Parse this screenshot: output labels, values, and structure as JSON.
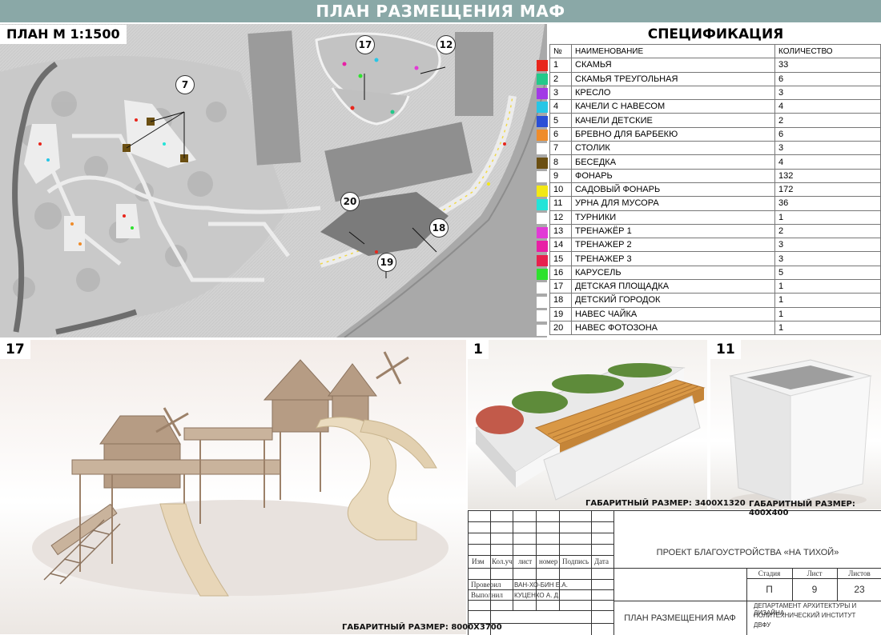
{
  "header": {
    "title": "ПЛАН РАЗМЕЩЕНИЯ МАФ"
  },
  "plan": {
    "label": "ПЛАН М 1:1500",
    "callouts": [
      "7",
      "17",
      "12",
      "20",
      "18",
      "19"
    ]
  },
  "spec": {
    "title": "СПЕЦИФИКАЦИЯ",
    "headers": {
      "num": "№",
      "name": "НАИМЕНОВАНИЕ",
      "qty": "КОЛИЧЕСТВО"
    },
    "rows": [
      {
        "num": "1",
        "name": "СКАМЬЯ",
        "qty": "33",
        "color": "#e8261c"
      },
      {
        "num": "2",
        "name": "СКАМЬЯ ТРЕУГОЛЬНАЯ",
        "qty": "6",
        "color": "#23c98a"
      },
      {
        "num": "3",
        "name": "КРЕСЛО",
        "qty": "3",
        "color": "#a23ae6"
      },
      {
        "num": "4",
        "name": "КАЧЕЛИ С НАВЕСОМ",
        "qty": "4",
        "color": "#27c6e6"
      },
      {
        "num": "5",
        "name": "КАЧЕЛИ ДЕТСКИЕ",
        "qty": "2",
        "color": "#2a4fd6"
      },
      {
        "num": "6",
        "name": "БРЕВНО ДЛЯ БАРБЕКЮ",
        "qty": "6",
        "color": "#ef8c2a"
      },
      {
        "num": "7",
        "name": "СТОЛИК",
        "qty": "3",
        "color": "#ffffff"
      },
      {
        "num": "8",
        "name": "БЕСЕДКА",
        "qty": "4",
        "color": "#6b4f12"
      },
      {
        "num": "9",
        "name": "ФОНАРЬ",
        "qty": "132",
        "color": "#ffffff"
      },
      {
        "num": "10",
        "name": "САДОВЫЙ ФОНАРЬ",
        "qty": "172",
        "color": "#f3e814"
      },
      {
        "num": "11",
        "name": "УРНА ДЛЯ МУСОРА",
        "qty": "36",
        "color": "#24e4d8"
      },
      {
        "num": "12",
        "name": "ТУРНИКИ",
        "qty": "1",
        "color": "#ffffff"
      },
      {
        "num": "13",
        "name": "ТРЕНАЖЁР 1",
        "qty": "2",
        "color": "#e23ad6"
      },
      {
        "num": "14",
        "name": "ТРЕНАЖЕР 2",
        "qty": "3",
        "color": "#e81fa5"
      },
      {
        "num": "15",
        "name": "ТРЕНАЖЕР 3",
        "qty": "3",
        "color": "#e8214d"
      },
      {
        "num": "16",
        "name": "КАРУСЕЛЬ",
        "qty": "5",
        "color": "#2ee22e"
      },
      {
        "num": "17",
        "name": "ДЕТСКАЯ ПЛОЩАДКА",
        "qty": "1",
        "color": "#ffffff"
      },
      {
        "num": "18",
        "name": "ДЕТСКИЙ ГОРОДОК",
        "qty": "1",
        "color": "#ffffff"
      },
      {
        "num": "19",
        "name": "НАВЕС ЧАЙКА",
        "qty": "1",
        "color": "#ffffff"
      },
      {
        "num": "20",
        "name": "НАВЕС ФОТОЗОНА",
        "qty": "1",
        "color": "#ffffff"
      }
    ]
  },
  "panels": {
    "p17": {
      "num": "17",
      "caption": "ГАБАРИТНЫЙ РАЗМЕР: 8000Х3700"
    },
    "p1": {
      "num": "1",
      "caption": "ГАБАРИТНЫЙ РАЗМЕР: 3400Х1320"
    },
    "p11": {
      "num": "11",
      "caption": "ГАБАРИТНЫЙ РАЗМЕР: 400Х400"
    }
  },
  "stamp": {
    "project": "ПРОЕКТ БЛАГОУСТРОЙСТВА «НА ТИХОЙ»",
    "cols": [
      "Изм",
      "Кол.уч",
      "лист",
      "номер",
      "Подпись",
      "Дата"
    ],
    "checked_label": "Проверил",
    "checked_name": "ВАН-ХО-БИН Е.А.",
    "done_label": "Выполнил",
    "done_name": "КУЦЕНКО А. Д.",
    "stage_label": "Стадия",
    "sheet_label": "Лист",
    "sheets_label": "Листов",
    "stage": "П",
    "sheet": "9",
    "sheets": "23",
    "drawing_title": "ПЛАН РАЗМЕЩЕНИЯ МАФ",
    "org1": "ДЕПАРТАМЕНТ АРХИТЕКТУРЫ И ДИЗАЙНА",
    "org2": "ПОЛИТЕХНИЧЕСКИЙ ИНСТИТУТ",
    "org3": "ДВФУ"
  }
}
